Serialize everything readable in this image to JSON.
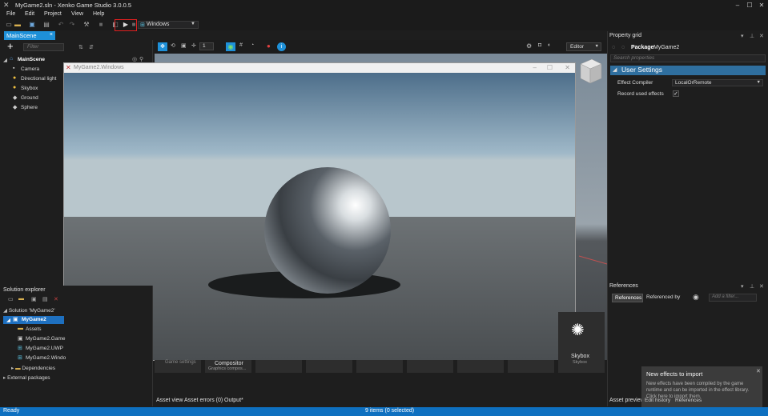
{
  "app": {
    "title": "MyGame2.sln - Xenko Game Studio 3.0.0.5"
  },
  "menu": [
    "File",
    "Edit",
    "Project",
    "View",
    "Help"
  ],
  "toolbar": {
    "platform_value": "Windows"
  },
  "document_tab": {
    "label": "MainScene",
    "close": "×"
  },
  "scene_tree": {
    "filter_placeholder": "Filter",
    "root": "MainScene",
    "items": [
      {
        "label": "Camera",
        "icon": "camera-icon"
      },
      {
        "label": "Directional light",
        "icon": "light-icon"
      },
      {
        "label": "Skybox",
        "icon": "light-icon"
      },
      {
        "label": "Ground",
        "icon": "entity-icon"
      },
      {
        "label": "Sphere",
        "icon": "entity-icon"
      }
    ]
  },
  "viewport": {
    "gizmo_number": "1",
    "mode_value": "Editor"
  },
  "game_window": {
    "title": "MyGame2.Windows"
  },
  "property_grid": {
    "panel_title": "Property grid",
    "package_label": "Package",
    "package_name": "MyGame2",
    "search_placeholder": "Search properties",
    "section": "User Settings",
    "effect_compiler_label": "Effect Compiler",
    "effect_compiler_value": "LocalOrRemote",
    "record_effects_label": "Record used effects",
    "record_effects_checked": "✓"
  },
  "references": {
    "panel_title": "References",
    "tab_references": "References",
    "tab_referenced_by": "Referenced by",
    "filter_placeholder": "Add a filter..."
  },
  "solution_explorer": {
    "panel_title": "Solution explorer",
    "solution": "Solution 'MyGame2'",
    "project": "MyGame2",
    "items": [
      "Assets",
      "MyGame2.Game",
      "MyGame2.UWP",
      "MyGame2.Windo",
      "Dependencies",
      "External packages"
    ]
  },
  "asset_view": {
    "tiles": [
      {
        "title": "Game settings",
        "subtitle": ""
      },
      {
        "title": "Compositor",
        "subtitle": "Graphics compos..."
      },
      {
        "title": "Skybox",
        "subtitle": "Skybox"
      }
    ],
    "tabs": [
      "Asset view",
      "Asset errors (0)",
      "Output*"
    ],
    "right_tab_1": "Asset preview",
    "right_tab_2": "Edit history",
    "right_tab_3": "References"
  },
  "status": {
    "left": "Ready",
    "center": "9 items (0 selected)"
  },
  "notification": {
    "title": "New effects to import",
    "body": "New effects have been compiled by the game runtime and can be imported in the effect library. Click here to import them."
  },
  "colors": {
    "accent": "#1e90d8",
    "status_bar": "#0e70c0",
    "highlight_box": "#e02020"
  }
}
